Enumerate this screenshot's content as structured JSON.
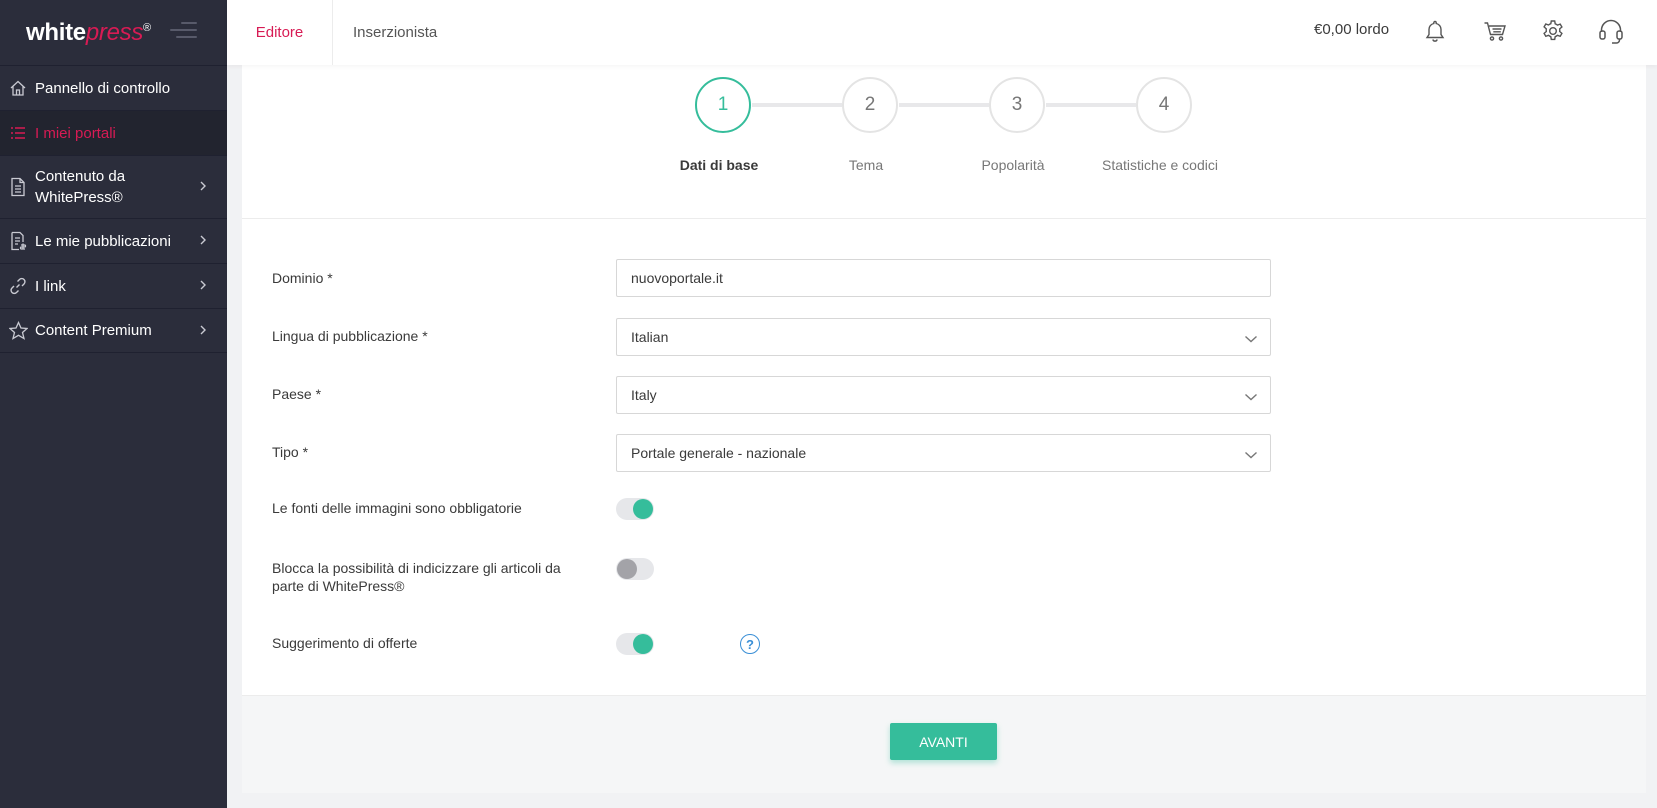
{
  "brand": {
    "name_main": "white",
    "name_accent": "press",
    "mark": "®"
  },
  "colors": {
    "accent": "#d71b54",
    "success": "#35bd9b",
    "sidebar_bg": "#2b2d3b",
    "help": "#3a8fd6"
  },
  "sidebar": {
    "items": [
      {
        "label": "Pannello di controllo",
        "icon": "home-icon",
        "chevron": false
      },
      {
        "label": "I miei portali",
        "icon": "list-icon",
        "chevron": false,
        "active": true
      },
      {
        "label": "Contenuto da WhitePress®",
        "icon": "document-icon",
        "chevron": true
      },
      {
        "label": "Le mie pubblicazioni",
        "icon": "invoice-icon",
        "chevron": true
      },
      {
        "label": "I link",
        "icon": "link-icon",
        "chevron": true
      },
      {
        "label": "Content Premium",
        "icon": "star-icon",
        "chevron": true
      }
    ]
  },
  "header": {
    "tabs": [
      {
        "label": "Editore",
        "active": true
      },
      {
        "label": "Inserzionista",
        "active": false
      }
    ],
    "balance": "€0,00 lordo",
    "icons": [
      "bell-icon",
      "cart-icon",
      "gear-icon",
      "headset-icon"
    ]
  },
  "wizard": {
    "steps": [
      {
        "number": "1",
        "label": "Dati di base",
        "active": true
      },
      {
        "number": "2",
        "label": "Tema",
        "active": false
      },
      {
        "number": "3",
        "label": "Popolarità",
        "active": false
      },
      {
        "number": "4",
        "label": "Statistiche e codici",
        "active": false
      }
    ]
  },
  "form": {
    "domain": {
      "label": "Dominio *",
      "value": "nuovoportale.it"
    },
    "language": {
      "label": "Lingua di pubblicazione *",
      "value": "Italian"
    },
    "country": {
      "label": "Paese *",
      "value": "Italy"
    },
    "type": {
      "label": "Tipo *",
      "value": "Portale generale - nazionale"
    },
    "image_sources": {
      "label": "Le fonti delle immagini sono obbligatorie",
      "enabled": true
    },
    "block_indexing": {
      "label": "Blocca la possibilità di indicizzare gli articoli da parte di WhitePress®",
      "enabled": false
    },
    "offer_suggestion": {
      "label": "Suggerimento di offerte",
      "enabled": true,
      "help": "?"
    }
  },
  "footer": {
    "next_label": "AVANTI"
  }
}
